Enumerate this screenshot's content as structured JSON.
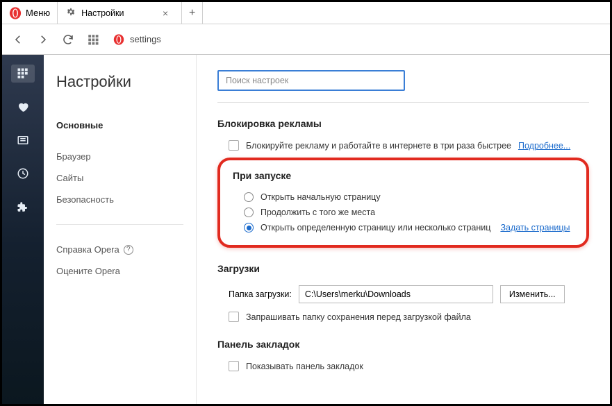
{
  "menu_label": "Меню",
  "tab": {
    "title": "Настройки"
  },
  "address": {
    "url_text": "settings"
  },
  "sidebar": {
    "title": "Настройки",
    "items": [
      "Основные",
      "Браузер",
      "Сайты",
      "Безопасность"
    ],
    "help_label": "Справка Opera",
    "rate_label": "Оцените Opera"
  },
  "search": {
    "placeholder": "Поиск настроек"
  },
  "sections": {
    "ads": {
      "title": "Блокировка рекламы",
      "checkbox_label": "Блокируйте рекламу и работайте в интернете в три раза быстрее",
      "more_link": "Подробнее..."
    },
    "startup": {
      "title": "При запуске",
      "opt1": "Открыть начальную страницу",
      "opt2": "Продолжить с того же места",
      "opt3": "Открыть определенную страницу или несколько страниц",
      "set_pages_link": "Задать страницы"
    },
    "downloads": {
      "title": "Загрузки",
      "folder_label": "Папка загрузки:",
      "folder_path": "C:\\Users\\merku\\Downloads",
      "change_btn": "Изменить...",
      "ask_checkbox": "Запрашивать папку сохранения перед загрузкой файла"
    },
    "bookmarks_bar": {
      "title": "Панель закладок",
      "show_checkbox": "Показывать панель закладок"
    }
  }
}
